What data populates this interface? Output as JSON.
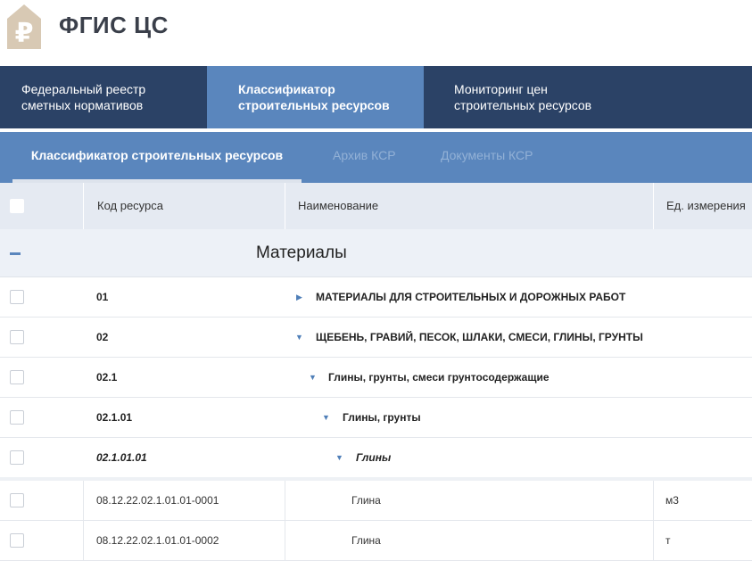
{
  "header": {
    "logo_glyph": "₽",
    "logo_color": "#d8c9b4",
    "site_title": "ФГИС ЦС"
  },
  "main_nav": {
    "tabs": [
      {
        "line1": "Федеральный реестр",
        "line2": "сметных нормативов"
      },
      {
        "line1": "Классификатор",
        "line2": "строительных ресурсов",
        "active": true
      },
      {
        "line1": "Мониторинг цен",
        "line2": "строительных ресурсов"
      }
    ]
  },
  "sub_nav": {
    "tabs": [
      {
        "label": "Классификатор строительных ресурсов",
        "active": true
      },
      {
        "label": "Архив КСР"
      },
      {
        "label": "Документы КСР"
      }
    ]
  },
  "table": {
    "columns": [
      "Код ресурса",
      "Наименование",
      "Ед. измерения"
    ],
    "group_title": "Материалы",
    "tree_rows": [
      {
        "code": "01",
        "name": "МАТЕРИАЛЫ ДЛЯ СТРОИТЕЛЬНЫХ И ДОРОЖНЫХ РАБОТ",
        "arrow": "▶"
      },
      {
        "code": "02",
        "name": "ЩЕБЕНЬ, ГРАВИЙ, ПЕСОК, ШЛАКИ, СМЕСИ, ГЛИНЫ, ГРУНТЫ",
        "arrow": "▼"
      },
      {
        "code": "02.1",
        "name": "Глины, грунты, смеси грунтосодержащие",
        "arrow": "▼"
      },
      {
        "code": "02.1.01",
        "name": "Глины, грунты",
        "arrow": "▼"
      },
      {
        "code": "02.1.01.01",
        "name": "Глины",
        "arrow": "▼"
      }
    ],
    "items": [
      {
        "code": "08.12.22.02.1.01.01-0001",
        "name": "Глина",
        "unit": "м3"
      },
      {
        "code": "08.12.22.02.1.01.01-0002",
        "name": "Глина",
        "unit": "т"
      }
    ]
  },
  "colors": {
    "nav_dark": "#2b4266",
    "nav_active": "#5a86bd",
    "header_row": "#e5eaf2"
  }
}
